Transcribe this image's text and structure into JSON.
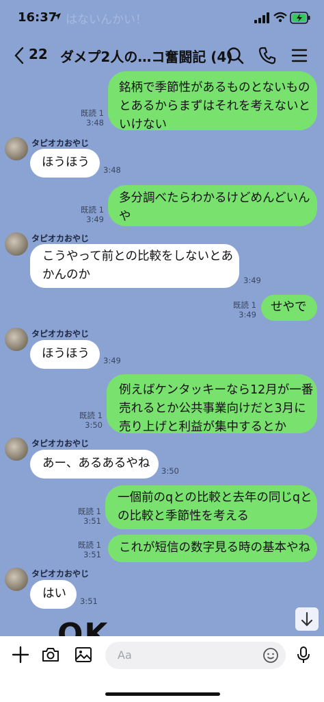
{
  "status_bar": {
    "time": "16:37"
  },
  "header": {
    "back_count": "22",
    "title": "ダメプ2人の…コ奮闘記 (4)"
  },
  "background_snippet": "はないんかい！",
  "messages": [
    {
      "side": "sent",
      "lines": [
        "銘柄で季節性があるものとないもの",
        "とあるからまずはそれを考えないと",
        "いけない"
      ],
      "read": "既読 1",
      "time": "3:48"
    },
    {
      "side": "recv",
      "sender": "タピオカおやじ",
      "lines": [
        "ほうほう"
      ],
      "time": "3:48"
    },
    {
      "side": "sent",
      "lines": [
        "多分調べたらわかるけどめんどいん",
        "や"
      ],
      "read": "既読 1",
      "time": "3:49"
    },
    {
      "side": "recv",
      "sender": "タピオカおやじ",
      "lines": [
        "こうやって前との比較をしないとあ",
        "かんのか"
      ],
      "time": "3:49"
    },
    {
      "side": "sent",
      "lines": [
        "せやで"
      ],
      "read": "既読 1",
      "time": "3:49"
    },
    {
      "side": "recv",
      "sender": "タピオカおやじ",
      "lines": [
        "ほうほう"
      ],
      "time": "3:49"
    },
    {
      "side": "sent",
      "lines": [
        "例えばケンタッキーなら12月が一番",
        "売れるとか公共事業向けだと3月に",
        "売り上げと利益が集中するとか"
      ],
      "read": "既読 1",
      "time": "3:50"
    },
    {
      "side": "recv",
      "sender": "タピオカおやじ",
      "lines": [
        "あー、あるあるやね"
      ],
      "time": "3:50"
    },
    {
      "side": "sent",
      "lines": [
        "一個前のqとの比較と去年の同じqと",
        "の比較と季節性を考える"
      ],
      "read": "既読 1",
      "time": "3:51"
    },
    {
      "side": "sent",
      "lines": [
        "これが短信の数字見る時の基本やね"
      ],
      "read": "既読 1",
      "time": "3:51"
    },
    {
      "side": "recv",
      "sender": "タピオカおやじ",
      "lines": [
        "はい"
      ],
      "time": "3:51"
    }
  ],
  "sticker_text": "OK",
  "composer": {
    "placeholder": "Aa"
  },
  "icons": [
    "location-arrow-icon",
    "signal-icon",
    "wifi-icon",
    "battery-icon",
    "back-chevron-icon",
    "search-icon",
    "phone-icon",
    "menu-icon",
    "plus-icon",
    "camera-icon",
    "image-icon",
    "emoji-icon",
    "mic-icon",
    "scroll-down-icon"
  ],
  "colors": {
    "background": "#8aa3d3",
    "sent_bubble": "#79e16e",
    "received_bubble": "#ffffff"
  }
}
